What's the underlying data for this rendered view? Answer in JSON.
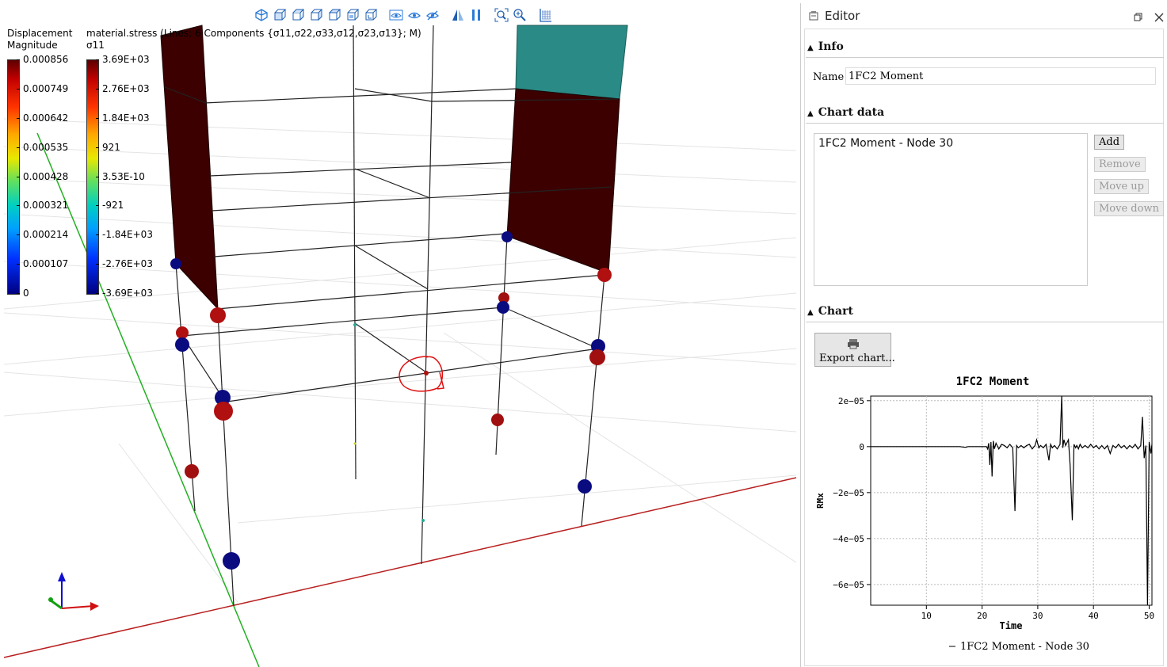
{
  "toolbar": {
    "icons": [
      "iso-view-icon",
      "view-front-icon",
      "view-back-icon",
      "view-left-icon",
      "view-right-icon",
      "view-top-icon",
      "view-bottom-icon",
      "show-icon",
      "eye-icon",
      "hide-icon",
      "perspective-icon",
      "split-icon",
      "zoom-fit-icon",
      "zoom-icon",
      "grid-icon"
    ]
  },
  "legend_displacement": {
    "title_line1": "Displacement",
    "title_line2": "Magnitude",
    "ticks": [
      "0.000856",
      "0.000749",
      "0.000642",
      "0.000535",
      "0.000428",
      "0.000321",
      "0.000214",
      "0.000107",
      "0"
    ]
  },
  "legend_stress": {
    "title_line1": "material.stress (Lines; 6 Components {σ11,σ22,σ33,σ12,σ23,σ13}; M)",
    "title_line2": "σ11",
    "ticks": [
      "3.69E+03",
      "2.76E+03",
      "1.84E+03",
      "921",
      "3.53E-10",
      "-921",
      "-1.84E+03",
      "-2.76E+03",
      "-3.69E+03"
    ]
  },
  "editor": {
    "title": "Editor",
    "info_section": "Info",
    "name_label": "Name",
    "name_value": "1FC2 Moment",
    "chart_data_section": "Chart data",
    "chart_items": [
      "1FC2 Moment - Node 30"
    ],
    "add_label": "Add",
    "remove_label": "Remove",
    "move_up_label": "Move up",
    "move_down_label": "Move down",
    "chart_section": "Chart",
    "export_label": "Export chart..."
  },
  "chart_data": {
    "type": "line",
    "title": "1FC2 Moment",
    "xlabel": "Time",
    "ylabel": "RMx",
    "xlim": [
      0,
      50.5
    ],
    "ylim": [
      -6.9e-05,
      2.2e-05
    ],
    "xticks": [
      10,
      20,
      30,
      40,
      50
    ],
    "xtick_labels": [
      "10",
      "20",
      "30",
      "40",
      "50"
    ],
    "yticks": [
      2e-05,
      0,
      -2e-05,
      -4e-05,
      -6e-05
    ],
    "ytick_labels": [
      "2e−05",
      "0",
      "−2e−05",
      "−4e−05",
      "−6e−05"
    ],
    "grid": true,
    "legend": "bottom",
    "series": [
      {
        "name": "1FC2 Moment - Node 30",
        "color": "#000000",
        "x": [
          0,
          15,
          16,
          17,
          17.5,
          18,
          19,
          20,
          20.8,
          21,
          21.2,
          21.4,
          21.6,
          21.8,
          22,
          22.2,
          22.5,
          23,
          23.5,
          24,
          24.5,
          25,
          25.5,
          25.9,
          26.2,
          26.5,
          27,
          27.5,
          28,
          28.5,
          29,
          29.5,
          29.8,
          30.2,
          30.5,
          31,
          31.5,
          32,
          32.3,
          32.6,
          33,
          33.5,
          34,
          34.3,
          34.5,
          34.7,
          35,
          35.5,
          35.8,
          36.2,
          36.5,
          36.8,
          37,
          37.3,
          37.6,
          38,
          38.5,
          39,
          39.5,
          40,
          40.5,
          41,
          41.5,
          42,
          42.5,
          43,
          43.5,
          44,
          44.5,
          45,
          45.5,
          46,
          46.5,
          47,
          47.5,
          48,
          48.5,
          48.8,
          49.1,
          49.4,
          49.7,
          50,
          50.3,
          50.5
        ],
        "y": [
          0,
          0,
          0,
          -3e-07,
          0,
          0,
          0,
          0,
          0,
          -1e-06,
          1.5e-06,
          -8e-06,
          2e-06,
          -1.3e-05,
          2.5e-06,
          -1e-06,
          1.5e-06,
          -1e-06,
          1e-06,
          5e-07,
          -5e-07,
          1e-06,
          -5e-07,
          -2.8e-05,
          5e-07,
          -5e-07,
          5e-07,
          -5e-07,
          5e-07,
          1e-06,
          -1e-06,
          5e-07,
          3e-06,
          -5e-07,
          5e-07,
          -5e-07,
          1e-06,
          -6e-06,
          1e-06,
          -5e-07,
          5e-07,
          -1e-06,
          1e-06,
          2.2e-05,
          -5e-07,
          3e-06,
          5e-07,
          3e-06,
          -8e-06,
          -3.2e-05,
          1e-06,
          -5e-07,
          5e-07,
          -1e-06,
          1e-06,
          -5e-07,
          5e-07,
          -5e-07,
          1e-06,
          -5e-07,
          5e-07,
          -1e-06,
          5e-07,
          -1e-06,
          5e-07,
          -3e-06,
          5e-07,
          -5e-07,
          1e-06,
          -5e-07,
          5e-07,
          -1e-06,
          5e-07,
          -5e-07,
          1e-06,
          -1e-06,
          5e-07,
          1.3e-05,
          -5e-06,
          5e-07,
          -6.9e-05,
          2e-06,
          -3e-06,
          1e-06
        ]
      }
    ]
  }
}
